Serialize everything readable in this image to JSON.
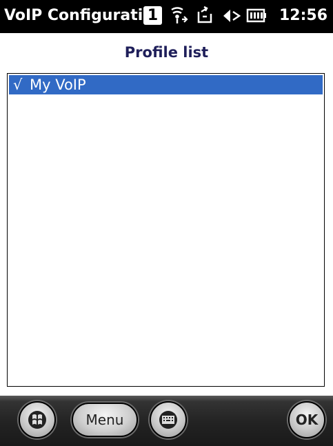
{
  "status_bar": {
    "app_title": "VoIP Configurati",
    "notification_count": "1",
    "time": "12:56",
    "icons": [
      "notification-icon",
      "connectivity-icon",
      "sync-icon",
      "volume-muted-icon",
      "battery-icon"
    ]
  },
  "main": {
    "title": "Profile list",
    "profiles": [
      {
        "check": "√",
        "name": "My VoIP",
        "selected": true
      }
    ]
  },
  "softkeys": {
    "menu_label": "Menu",
    "ok_label": "OK"
  },
  "colors": {
    "selection": "#316ac5",
    "title": "#1f1f5a"
  }
}
